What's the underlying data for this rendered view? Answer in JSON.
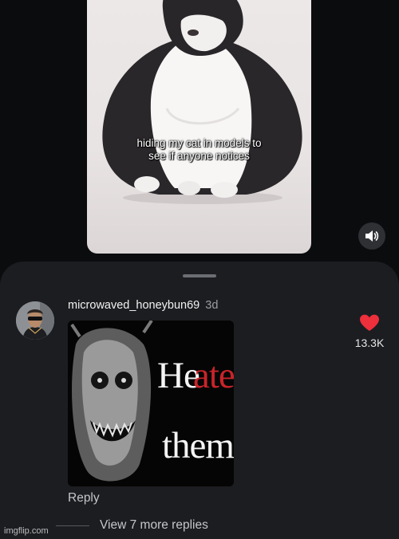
{
  "video": {
    "caption_line1": "hiding my cat in models to",
    "caption_line2": "see if anyone notices"
  },
  "sound_button": {
    "icon": "speaker-icon"
  },
  "comment": {
    "username": "microwaved_honeybun69",
    "time": "3d",
    "image_text": {
      "word1": "He",
      "word2": "ate",
      "word3": "them"
    },
    "reply_label": "Reply",
    "like_count": "13.3K",
    "liked": true
  },
  "replies": {
    "view_more_label": "View 7 more replies"
  },
  "watermark": "imgflip.com",
  "colors": {
    "background": "#0b0c0e",
    "sheet": "#1c1d21",
    "heart": "#ee2f3c",
    "muted_text": "#c4c6ca",
    "meme_red": "#c8242a"
  }
}
